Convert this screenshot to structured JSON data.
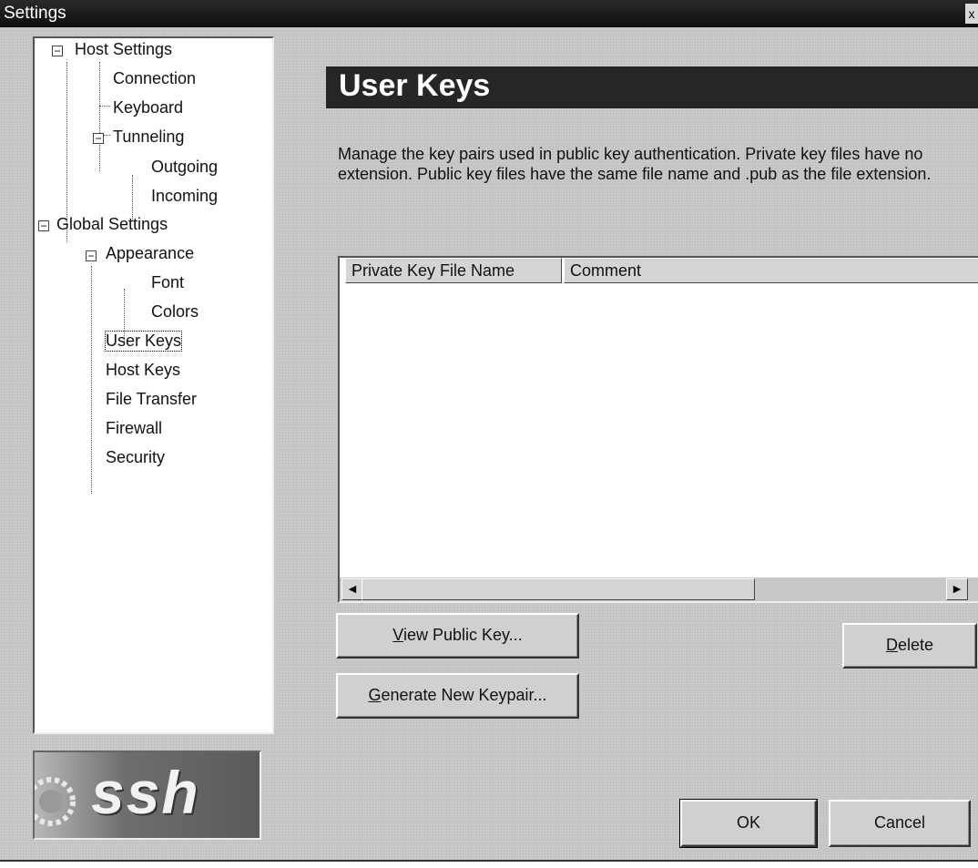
{
  "window": {
    "title": "Settings",
    "close_glyph": "x"
  },
  "tree": {
    "host_settings": "Host Settings",
    "connection": "Connection",
    "keyboard": "Keyboard",
    "tunneling": "Tunneling",
    "outgoing": "Outgoing",
    "incoming": "Incoming",
    "global_settings": "Global Settings",
    "appearance": "Appearance",
    "font": "Font",
    "colors": "Colors",
    "user_keys": "User Keys",
    "host_keys": "Host Keys",
    "file_transfer": "File Transfer",
    "firewall": "Firewall",
    "security": "Security",
    "selected": "User Keys",
    "expander_glyph": "−"
  },
  "logo": {
    "text": "ssh"
  },
  "panel": {
    "title": "User Keys",
    "description": "Manage the key pairs used in public key authentication. Private key files have no extension. Public key files have the same file name and .pub as the file extension."
  },
  "list": {
    "columns": [
      "Private Key File Name",
      "Comment"
    ],
    "rows": []
  },
  "buttons": {
    "view_public_key": {
      "mnemonic": "V",
      "rest": "iew Public Key..."
    },
    "generate_keypair": {
      "mnemonic": "G",
      "rest": "enerate New Keypair..."
    },
    "delete": {
      "mnemonic": "D",
      "rest": "elete"
    },
    "ok": "OK",
    "cancel": "Cancel"
  },
  "colors": {
    "title_bar": "#111111",
    "header_bar": "#262626",
    "dialog_bg": "#c8c8c8"
  },
  "icons": {
    "scroll_left": "triangle-left",
    "scroll_right": "triangle-right"
  }
}
